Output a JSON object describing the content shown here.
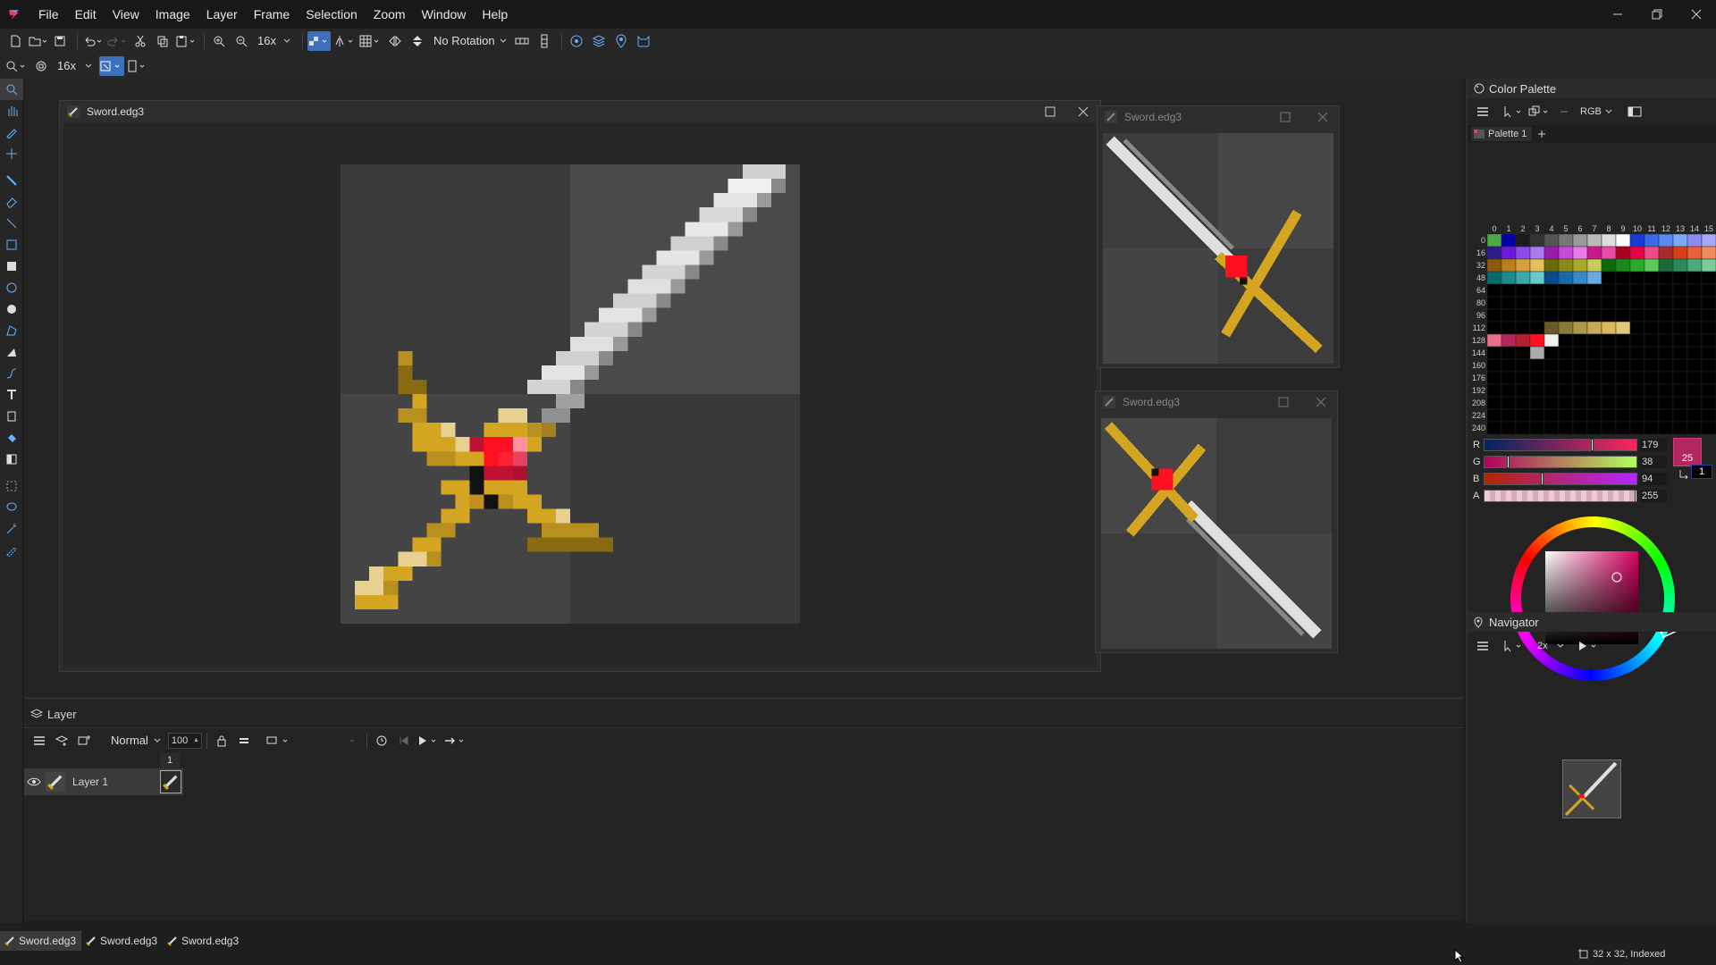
{
  "app": {
    "menu": [
      "File",
      "Edit",
      "View",
      "Image",
      "Layer",
      "Frame",
      "Selection",
      "Zoom",
      "Window",
      "Help"
    ]
  },
  "toolbar1": {
    "zoom_value": "16x",
    "rotation": "No Rotation"
  },
  "toolbar2": {
    "zoom_value": "16x"
  },
  "docs": {
    "main_title": "Sword.edg3",
    "preview1_title": "Sword.edg3",
    "preview2_title": "Sword.edg3"
  },
  "layer_panel": {
    "title": "Layer",
    "blend_mode": "Normal",
    "opacity": "100",
    "frame_number": "1",
    "layers": [
      {
        "name": "Layer 1"
      }
    ]
  },
  "color_palette": {
    "title": "Color Palette",
    "mode": "RGB",
    "palette_tab": "Palette 1",
    "col_headers": [
      "0",
      "1",
      "2",
      "3",
      "4",
      "5",
      "6",
      "7",
      "8",
      "9",
      "10",
      "11",
      "12",
      "13",
      "14",
      "15"
    ],
    "row_headers": [
      "0",
      "16",
      "32",
      "48",
      "64",
      "80",
      "96",
      "112",
      "128",
      "144",
      "160",
      "176",
      "192",
      "208",
      "224",
      "240"
    ],
    "channels": [
      {
        "label": "R",
        "value": "179"
      },
      {
        "label": "G",
        "value": "38"
      },
      {
        "label": "B",
        "value": "94"
      },
      {
        "label": "A",
        "value": "255"
      }
    ],
    "primary_index": "25",
    "secondary_index": "1",
    "current_color": "#b3265e"
  },
  "navigator": {
    "title": "Navigator",
    "zoom": "2x"
  },
  "statusbar": {
    "tabs": [
      "Sword.edg3",
      "Sword.edg3",
      "Sword.edg3"
    ],
    "image_info": "32 x 32, Indexed"
  }
}
